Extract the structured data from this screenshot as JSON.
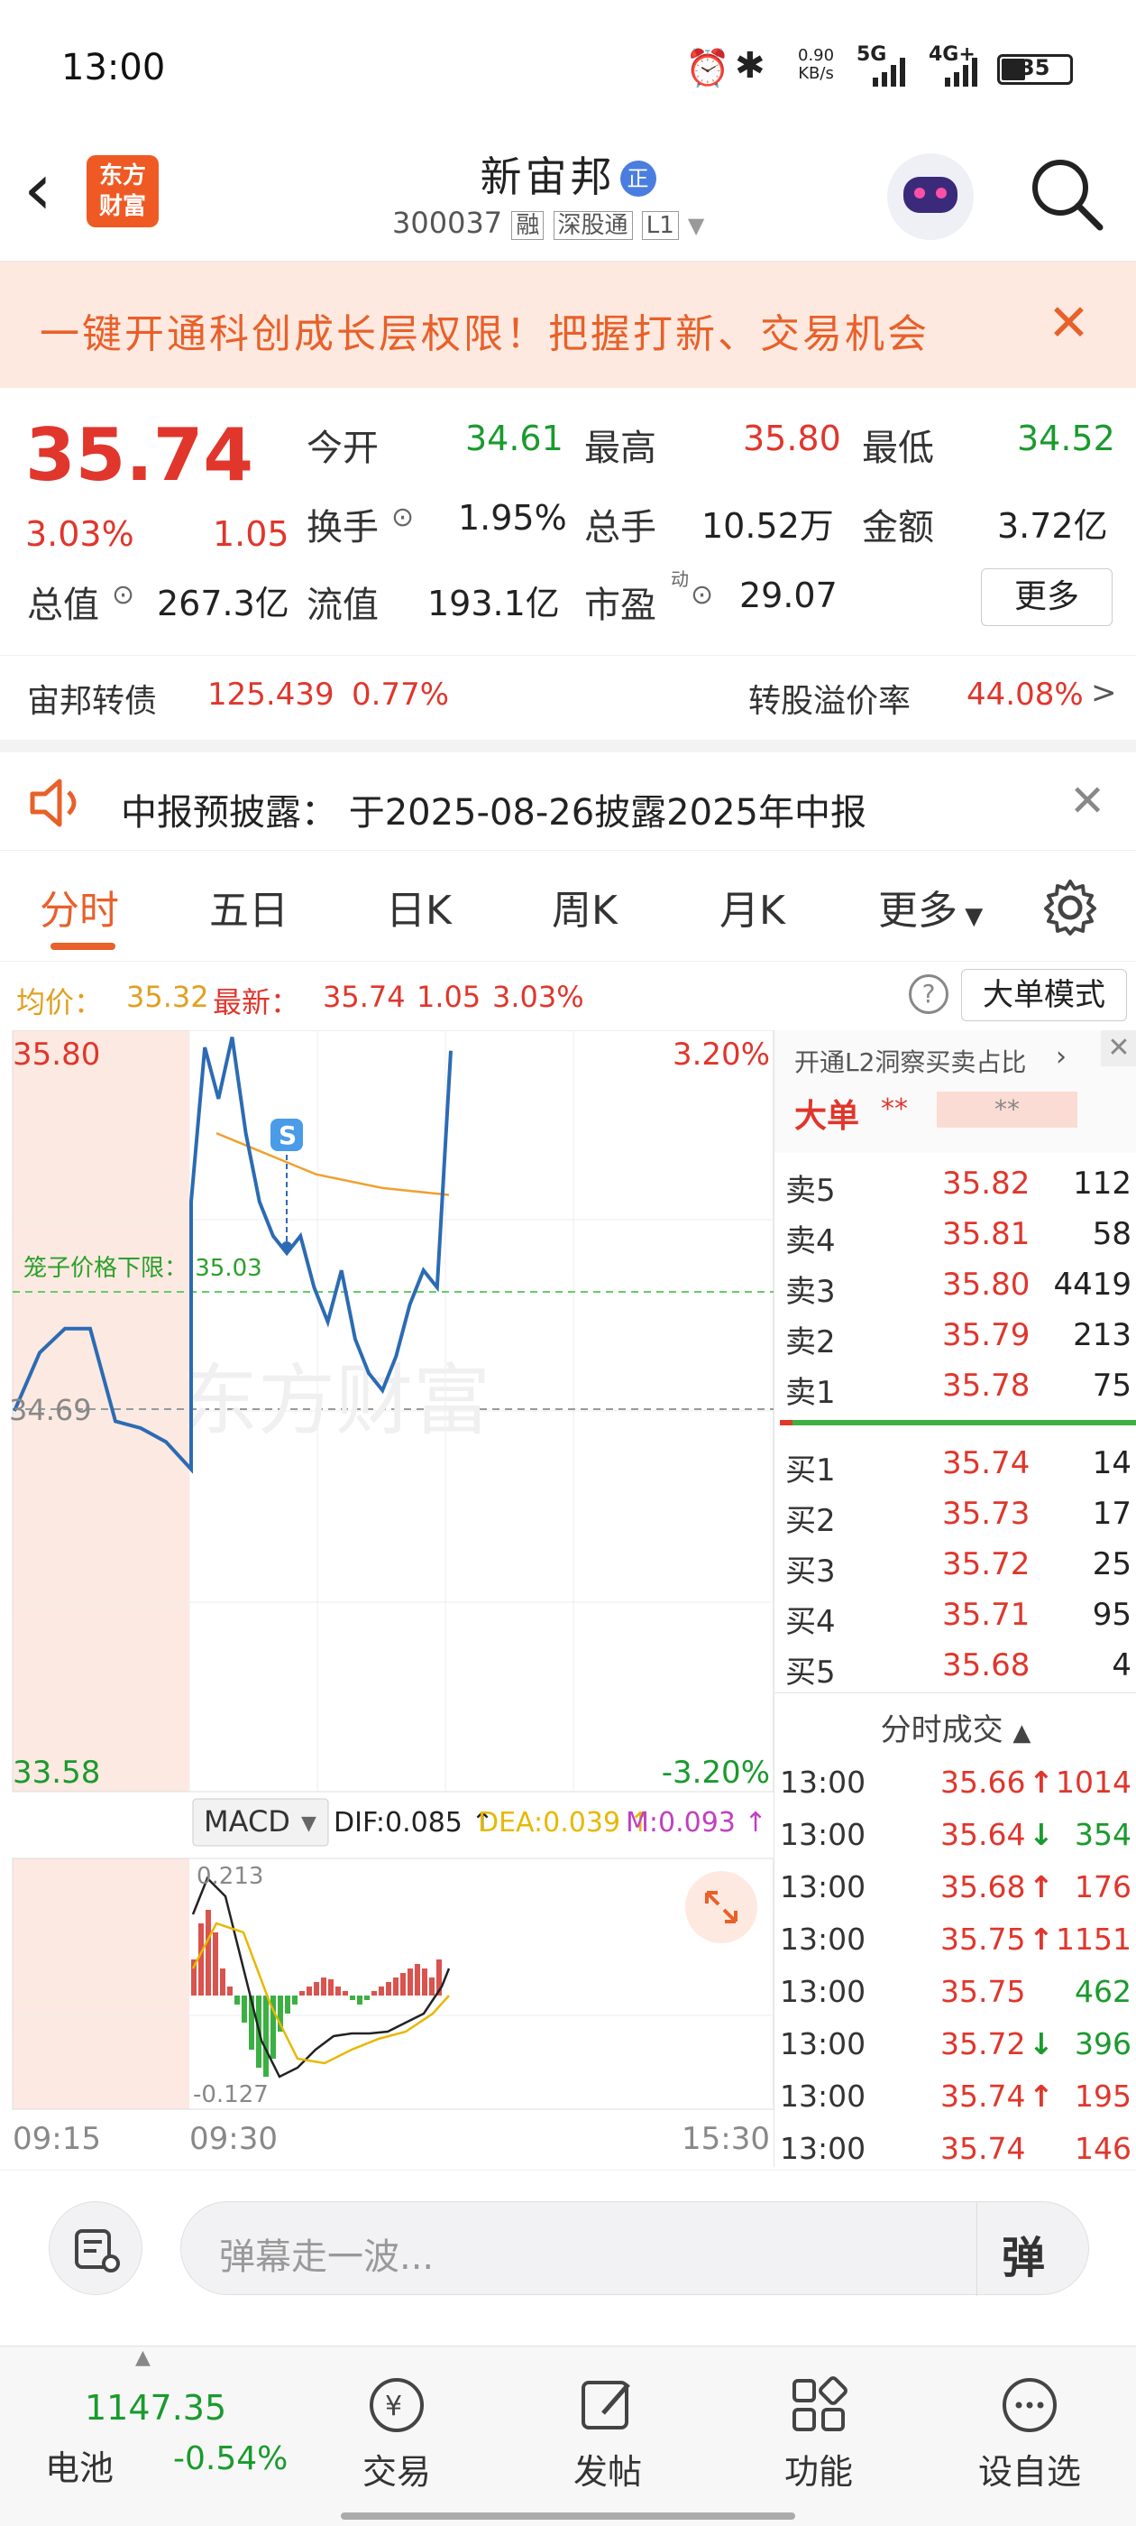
{
  "status": {
    "time": "13:00",
    "net_speed_top": "0.90",
    "net_speed_bottom": "KB/s",
    "sig1": "5G",
    "sig2": "4G+",
    "battery": "35"
  },
  "header": {
    "title": "新宙邦",
    "badge": "正",
    "code": "300037",
    "tags": [
      "融",
      "深股通",
      "L1"
    ],
    "logo_line1": "东方",
    "logo_line2": "财富"
  },
  "banner": {
    "text": "一键开通科创成长层权限！把握打新、交易机会"
  },
  "quote": {
    "price": "35.74",
    "pct": "3.03%",
    "chg": "1.05",
    "open_label": "今开",
    "open": "34.61",
    "high_label": "最高",
    "high": "35.80",
    "low_label": "最低",
    "low": "34.52",
    "turnover_label": "换手",
    "turnover": "1.95%",
    "volume_label": "总手",
    "volume": "10.52万",
    "amount_label": "金额",
    "amount": "3.72亿",
    "mcap_label": "总值",
    "mcap": "267.3亿",
    "float_label": "流值",
    "float": "193.1亿",
    "pe_label": "市盈",
    "pe_sup": "动",
    "pe": "29.07",
    "more_btn": "更多",
    "bond_label": "宙邦转债",
    "bond_price": "125.439",
    "bond_pct": "0.77%",
    "premium_label": "转股溢价率",
    "premium": "44.08%"
  },
  "notice": {
    "text": "中报预披露：  于2025-08-26披露2025年中报"
  },
  "tabs": {
    "items": [
      "分时",
      "五日",
      "日K",
      "周K",
      "月K",
      "更多"
    ],
    "active": 0
  },
  "info_row": {
    "avg_label": "均价：",
    "avg": "35.32",
    "latest_label": "最新：",
    "latest": "35.74",
    "chg": "1.05",
    "pct": "3.03%",
    "mode_btn": "大单模式"
  },
  "chart": {
    "y_top": "35.80",
    "y_bottom": "33.58",
    "pct_top": "3.20%",
    "pct_bottom": "-3.20%",
    "prev_close": "34.69",
    "cage_label": "笼子价格下限：  35.03",
    "watermark": "东方财富",
    "s_marker": "S",
    "time_start": "09:15",
    "time_mid": "09:30",
    "time_end": "15:30",
    "macd_label": "MACD",
    "dif": "DIF:0.085",
    "dea": "DEA:0.039",
    "m": "M:0.093",
    "macd_top": "0.213",
    "macd_bottom": "-0.127",
    "colors": {
      "price": "#2c6bb3",
      "avg": "#f0a030",
      "dif": "#222222",
      "dea": "#e8b800",
      "up": "#d9534f",
      "down": "#3cb043"
    }
  },
  "chart_data": {
    "type": "line",
    "title": "",
    "ylim": [
      33.58,
      35.8
    ],
    "series": [
      {
        "values": [
          34.69,
          34.86,
          34.93,
          34.93,
          34.66,
          34.64,
          34.6,
          34.52,
          35.3,
          35.75,
          35.6,
          35.78,
          35.5,
          35.3,
          35.2,
          35.15,
          35.2,
          35.05,
          34.95,
          35.1,
          34.9,
          34.8,
          34.75,
          34.85,
          35.0,
          35.1,
          35.05,
          35.74
        ]
      },
      {
        "values": [
          35.5,
          35.46,
          35.42,
          35.38,
          35.36,
          35.34,
          35.33,
          35.32
        ]
      }
    ]
  },
  "orderbook": {
    "l2_text": "开通L2洞察买卖占比",
    "big_label": "大单",
    "big_val1": "**",
    "big_val2": "**",
    "asks": [
      {
        "label": "卖5",
        "price": "35.82",
        "vol": "112"
      },
      {
        "label": "卖4",
        "price": "35.81",
        "vol": "58"
      },
      {
        "label": "卖3",
        "price": "35.80",
        "vol": "4419"
      },
      {
        "label": "卖2",
        "price": "35.79",
        "vol": "213"
      },
      {
        "label": "卖1",
        "price": "35.78",
        "vol": "75"
      }
    ],
    "bids": [
      {
        "label": "买1",
        "price": "35.74",
        "vol": "14"
      },
      {
        "label": "买2",
        "price": "35.73",
        "vol": "17"
      },
      {
        "label": "买3",
        "price": "35.72",
        "vol": "25"
      },
      {
        "label": "买4",
        "price": "35.71",
        "vol": "95"
      },
      {
        "label": "买5",
        "price": "35.68",
        "vol": "4"
      }
    ],
    "trades_title": "分时成交",
    "trades": [
      {
        "time": "13:00",
        "price": "35.66",
        "dir": "↑",
        "vol": "1014",
        "c": "red"
      },
      {
        "time": "13:00",
        "price": "35.64",
        "dir": "↓",
        "vol": "354",
        "c": "green"
      },
      {
        "time": "13:00",
        "price": "35.68",
        "dir": "↑",
        "vol": "176",
        "c": "red"
      },
      {
        "time": "13:00",
        "price": "35.75",
        "dir": "↑",
        "vol": "1151",
        "c": "red"
      },
      {
        "time": "13:00",
        "price": "35.75",
        "dir": "",
        "vol": "462",
        "c": "green"
      },
      {
        "time": "13:00",
        "price": "35.72",
        "dir": "↓",
        "vol": "396",
        "c": "green"
      },
      {
        "time": "13:00",
        "price": "35.74",
        "dir": "↑",
        "vol": "195",
        "c": "red"
      },
      {
        "time": "13:00",
        "price": "35.74",
        "dir": "",
        "vol": "146",
        "c": "red"
      }
    ]
  },
  "input": {
    "placeholder": "弹幕走一波...",
    "danmu_btn": "弹"
  },
  "bottom": {
    "index_value": "1147.35",
    "index_name": "电池",
    "index_pct": "-0.54%",
    "items": [
      "交易",
      "发帖",
      "功能",
      "设自选"
    ]
  }
}
